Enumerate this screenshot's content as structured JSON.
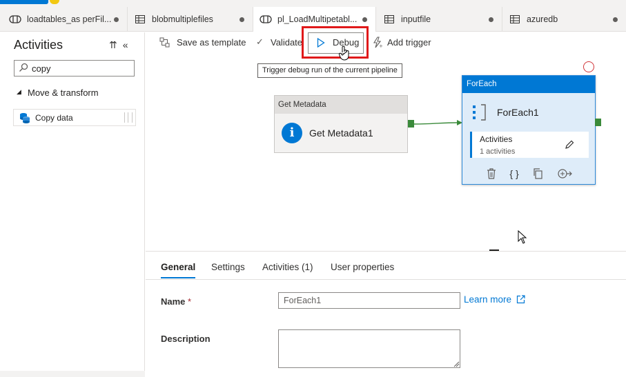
{
  "tabs": [
    {
      "label": "loadtables_as perFil...",
      "icon": "pipeline-icon",
      "state": "modified"
    },
    {
      "label": "blobmultiplefiles",
      "icon": "dataset-icon",
      "state": "modified"
    },
    {
      "label": "pl_LoadMultipetabl...",
      "icon": "pipeline-icon",
      "state": "modified",
      "active": true
    },
    {
      "label": "inputfile",
      "icon": "dataset-icon",
      "state": "modified"
    },
    {
      "label": "azuredb",
      "icon": "dataset-icon",
      "state": "modified"
    }
  ],
  "sidebar": {
    "title": "Activities",
    "search_value": "copy",
    "group_label": "Move & transform",
    "items": [
      {
        "label": "Copy data",
        "icon": "copy-data-icon"
      }
    ]
  },
  "toolbar": {
    "save_template": "Save as template",
    "validate": "Validate",
    "debug": "Debug",
    "add_trigger": "Add trigger"
  },
  "tooltip": "Trigger debug run of the current pipeline",
  "canvas": {
    "get_metadata": {
      "type": "Get Metadata",
      "name": "Get Metadata1"
    },
    "foreach": {
      "type": "ForEach",
      "name": "ForEach1",
      "inner_label": "Activities",
      "inner_sub": "1 activities"
    }
  },
  "panel": {
    "tabs": [
      "General",
      "Settings",
      "Activities (1)",
      "User properties"
    ],
    "active_tab": "General",
    "name_label": "Name",
    "name_required": "*",
    "name_value": "ForEach1",
    "learn_more": "Learn more",
    "description_label": "Description",
    "description_value": ""
  },
  "colors": {
    "accent": "#0078d4",
    "highlight_box": "#e0191a",
    "success_port": "#3a8a3a",
    "error_circle": "#d13438"
  }
}
